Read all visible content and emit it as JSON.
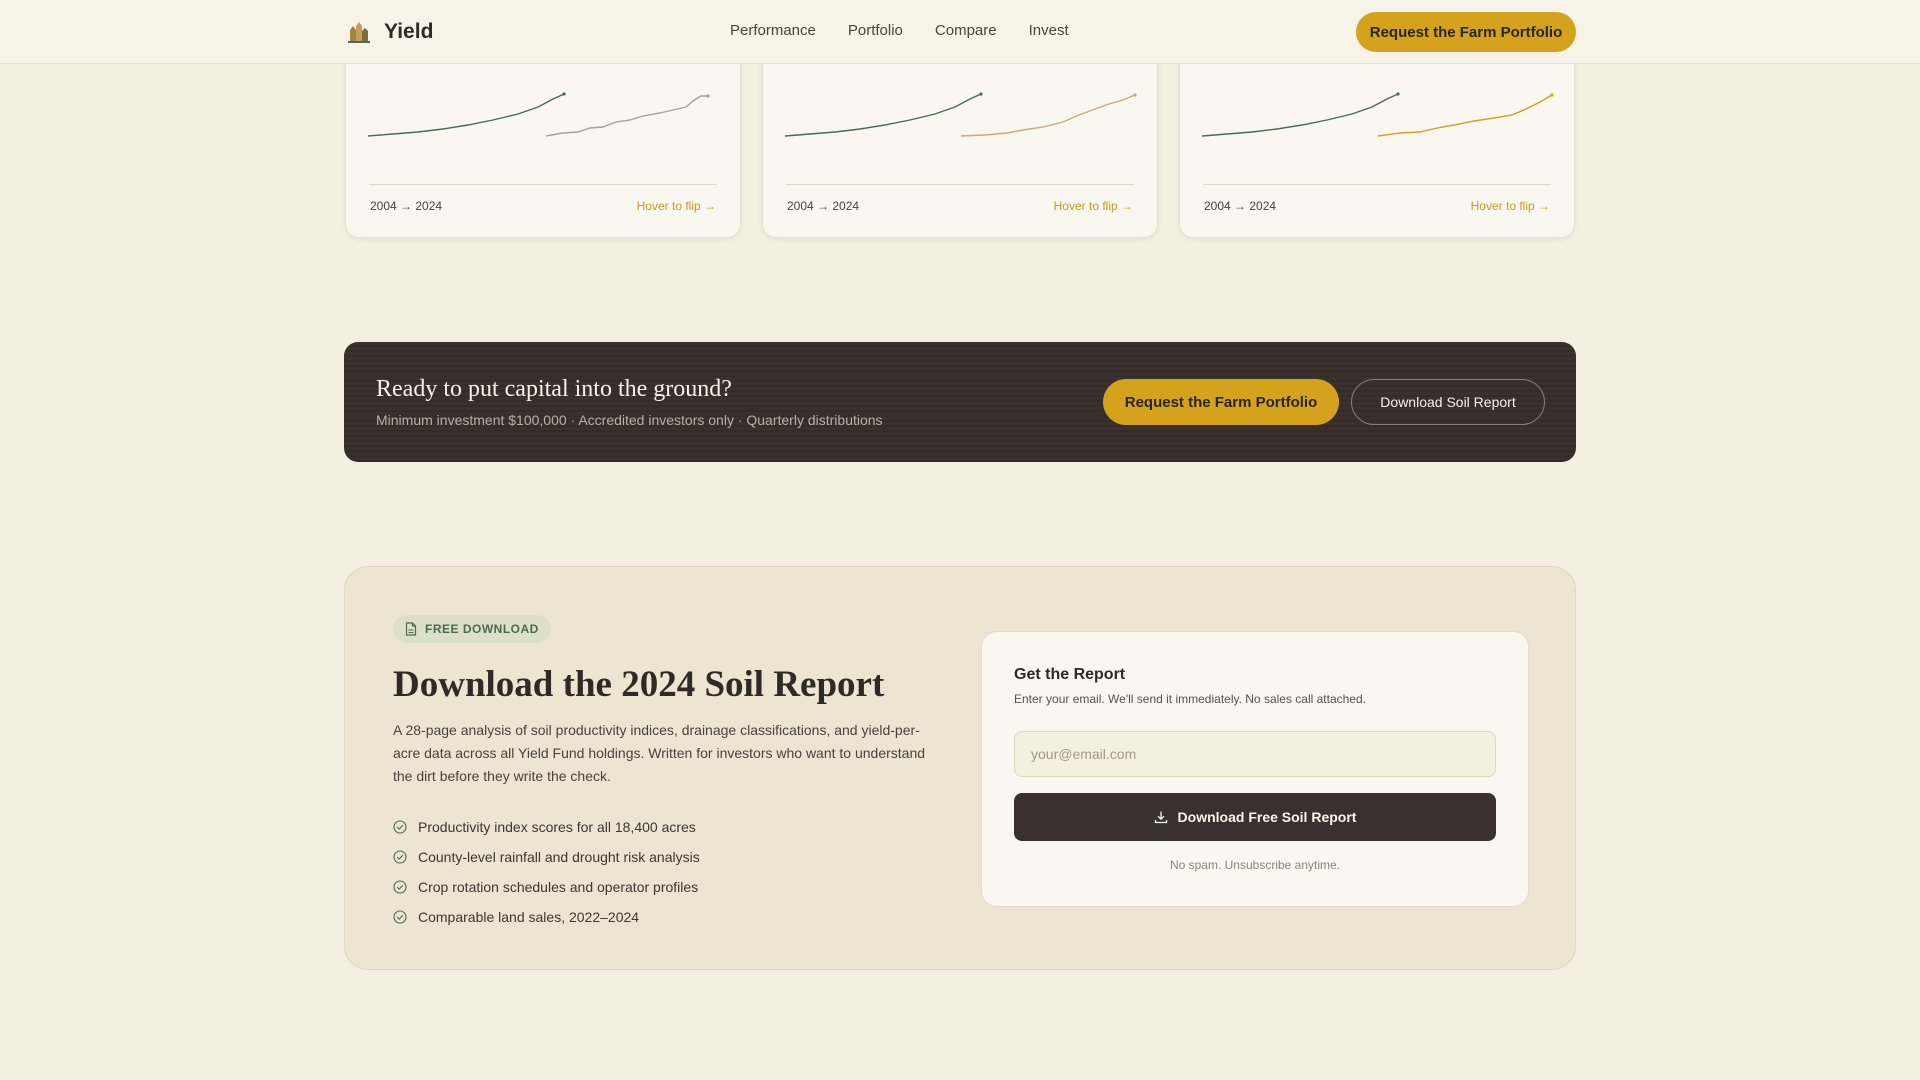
{
  "header": {
    "brand": "Yield",
    "nav": [
      "Performance",
      "Portfolio",
      "Compare",
      "Invest"
    ],
    "cta": "Request the Farm Portfolio"
  },
  "cards": [
    {
      "range": "2004 → 2024",
      "flip": "Hover to flip →"
    },
    {
      "range": "2004 → 2024",
      "flip": "Hover to flip →"
    },
    {
      "range": "2004 → 2024",
      "flip": "Hover to flip →"
    }
  ],
  "band": {
    "title": "Ready to put capital into the ground?",
    "subtitle": "Minimum investment $100,000 · Accredited investors only · Quarterly distributions",
    "primary": "Request the Farm Portfolio",
    "secondary": "Download Soil Report"
  },
  "soil": {
    "badge": "FREE DOWNLOAD",
    "title": "Download the 2024 Soil Report",
    "description": "A 28-page analysis of soil productivity indices, drainage classifications, and yield-per-acre data across all Yield Fund holdings. Written for investors who want to understand the dirt before they write the check.",
    "items": [
      "Productivity index scores for all 18,400 acres",
      "County-level rainfall and drought risk analysis",
      "Crop rotation schedules and operator profiles",
      "Comparable land sales, 2022–2024"
    ],
    "form": {
      "title": "Get the Report",
      "subtitle": "Enter your email. We'll send it immediately. No sales call attached.",
      "placeholder": "your@email.com",
      "button": "Download Free Soil Report",
      "footnote": "No spam. Unsubscribe anytime."
    }
  },
  "colors": {
    "accent": "#d4a21c",
    "green": "#4a6b52",
    "dark": "#3a302d",
    "background": "#f5efe2"
  }
}
